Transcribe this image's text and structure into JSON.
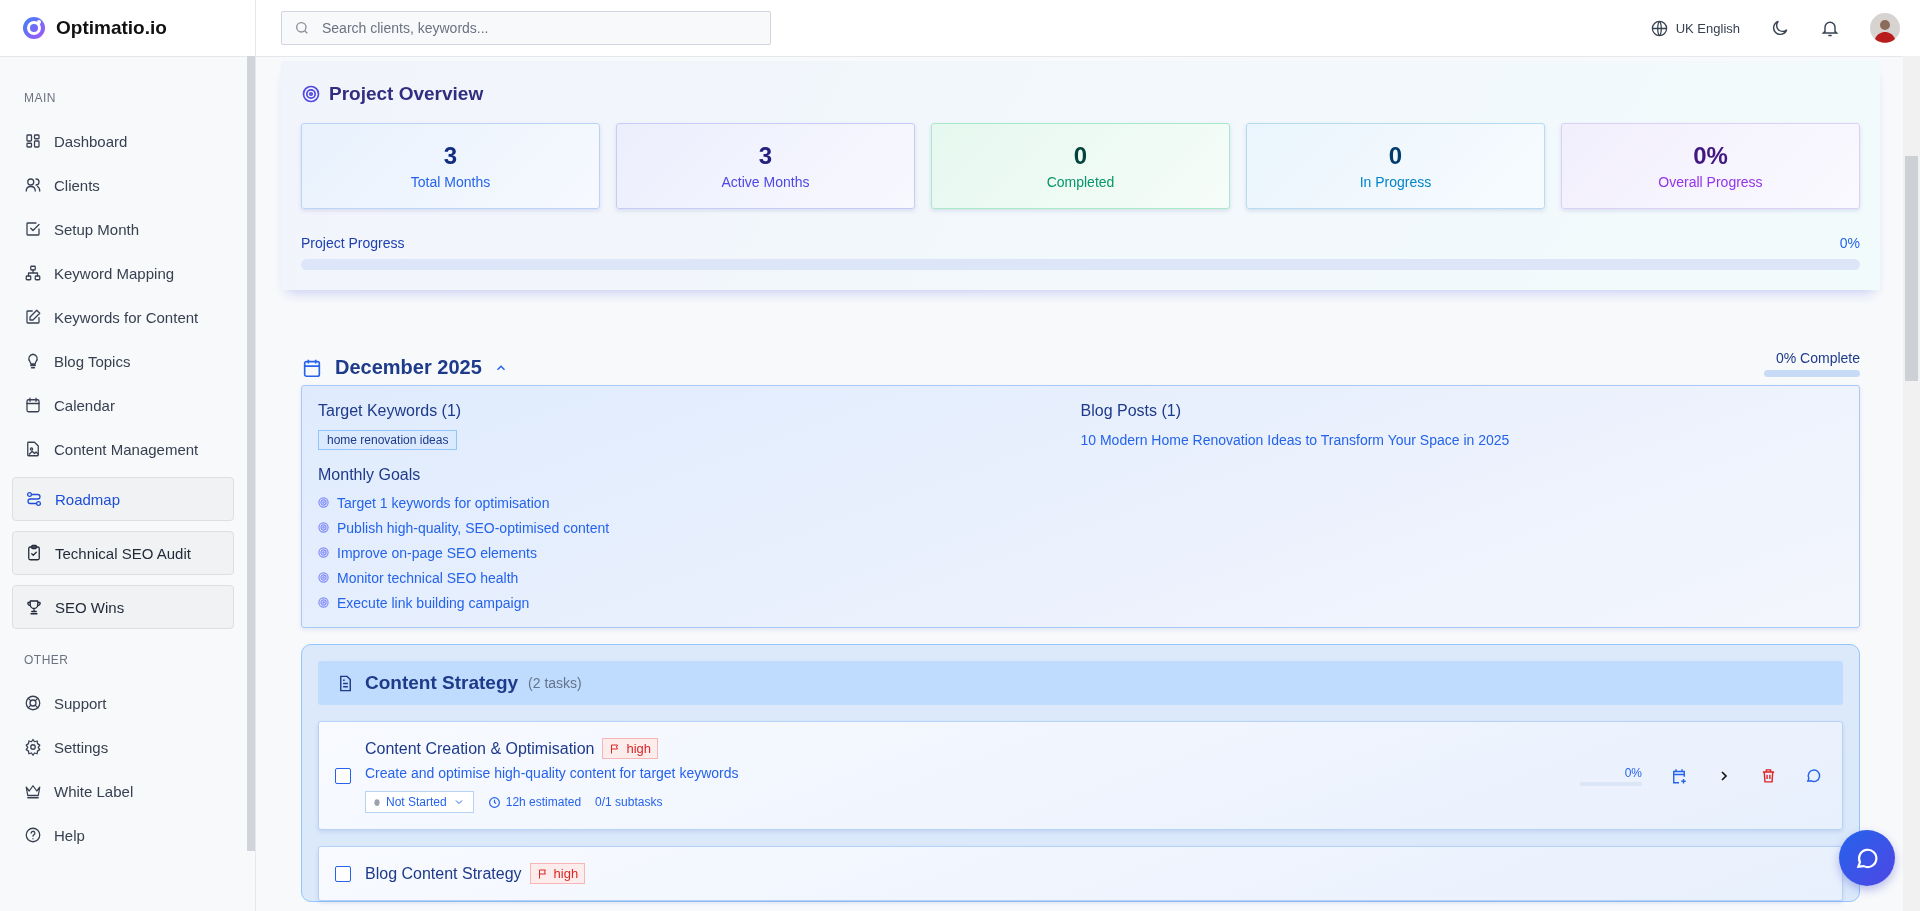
{
  "brand": {
    "name": "Optimatio.io"
  },
  "sidebar": {
    "sections": [
      {
        "title": "MAIN",
        "items": [
          {
            "label": "Dashboard",
            "kind": "link",
            "selected": false
          },
          {
            "label": "Clients",
            "kind": "link",
            "selected": false
          },
          {
            "label": "Setup Month",
            "kind": "link",
            "selected": false
          },
          {
            "label": "Keyword Mapping",
            "kind": "link",
            "selected": false
          },
          {
            "label": "Keywords for Content",
            "kind": "link",
            "selected": false
          },
          {
            "label": "Blog Topics",
            "kind": "link",
            "selected": false
          },
          {
            "label": "Calendar",
            "kind": "link",
            "selected": false
          },
          {
            "label": "Content Management",
            "kind": "link",
            "selected": false
          },
          {
            "label": "Roadmap",
            "kind": "card",
            "selected": true
          },
          {
            "label": "Technical SEO Audit",
            "kind": "card",
            "selected": false
          },
          {
            "label": "SEO Wins",
            "kind": "card",
            "selected": false
          }
        ]
      },
      {
        "title": "OTHER",
        "items": [
          {
            "label": "Support",
            "kind": "link",
            "selected": false
          },
          {
            "label": "Settings",
            "kind": "link",
            "selected": false
          },
          {
            "label": "White Label",
            "kind": "link",
            "selected": false
          },
          {
            "label": "Help",
            "kind": "link",
            "selected": false
          }
        ]
      }
    ]
  },
  "topbar": {
    "search": {
      "placeholder": "Search clients, keywords..."
    },
    "language": "UK English"
  },
  "overview": {
    "title": "Project Overview",
    "stats": [
      {
        "value": "3",
        "label": "Total Months",
        "color": "#2563eb"
      },
      {
        "value": "3",
        "label": "Active Months",
        "color": "#4f46e5"
      },
      {
        "value": "0",
        "label": "Completed",
        "color": "#059669"
      },
      {
        "value": "0",
        "label": "In Progress",
        "color": "#0284c7"
      },
      {
        "value": "0%",
        "label": "Overall Progress",
        "color": "#9333ea"
      }
    ],
    "progress": {
      "label": "Project Progress",
      "reading": "0%",
      "level": 0
    }
  },
  "month": {
    "title": "December 2025",
    "expanded": true,
    "complete": "0% Complete",
    "level": 0,
    "keywords_title": "Target Keywords (1)",
    "keywords": [
      "home renovation ideas"
    ],
    "goals_title": "Monthly Goals",
    "goals": [
      "Target 1 keywords for optimisation",
      "Publish high-quality, SEO-optimised content",
      "Improve on-page SEO elements",
      "Monitor technical SEO health",
      "Execute link building campaign"
    ],
    "posts_title": "Blog Posts (1)",
    "posts": [
      "10 Modern Home Renovation Ideas to Transform Your Space in 2025"
    ]
  },
  "strategy": {
    "title": "Content Strategy",
    "count": "(2 tasks)",
    "tasks": [
      {
        "title": "Content Creation & Optimisation",
        "priority": "high",
        "description": "Create and optimise high-quality content for target keywords",
        "status": "Not Started",
        "estimate": "12h estimated",
        "subtasks": "0/1 subtasks",
        "reading": "0%",
        "level": 0,
        "checked": false
      },
      {
        "title": "Blog Content Strategy",
        "priority": "high",
        "checked": false
      }
    ]
  }
}
